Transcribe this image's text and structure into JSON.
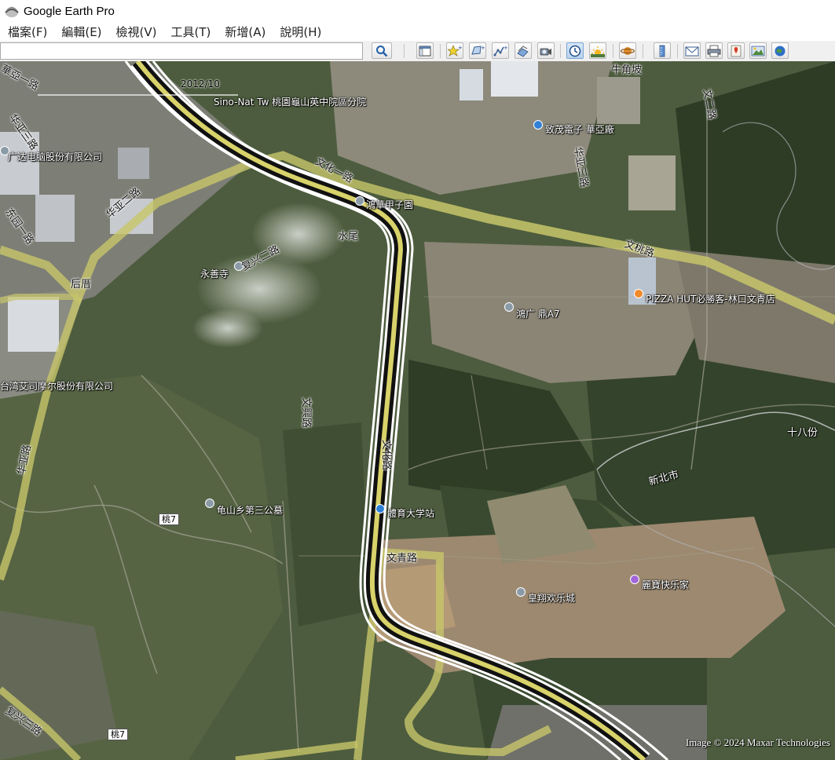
{
  "window": {
    "title": "Google Earth Pro"
  },
  "menu": [
    "檔案(F)",
    "編輯(E)",
    "檢視(V)",
    "工具(T)",
    "新增(A)",
    "說明(H)"
  ],
  "search": {
    "value": "",
    "placeholder": ""
  },
  "toolbar": {
    "icons": [
      "search-icon",
      "sidebar-toggle-icon",
      "placemark-icon",
      "polygon-icon",
      "path-icon",
      "overlay-icon",
      "tour-icon",
      "historical-imagery-icon",
      "sun-icon",
      "planets-icon",
      "ruler-icon",
      "email-icon",
      "print-icon",
      "save-image-icon",
      "maps-icon",
      "earth-icon"
    ]
  },
  "timeline": {
    "date": "2012/10"
  },
  "map": {
    "poi_labels": [
      "Sino-Nat Tw 桃園龜山英中院區分院",
      "致茂電子 華亞廠",
      "鴻華甲子園",
      "永善寺",
      "鴻广 鼎A7",
      "PIZZA HUT必勝客-林口文青店",
      "台湾艾司摩尔股份有限公司",
      "广达电脑股份有限公司",
      "龟山乡第三公墓",
      "體育大学站",
      "皇翔欢乐城",
      "麗寶快乐家"
    ],
    "road_labels": [
      "文化一路",
      "文化三路",
      "文化路",
      "文桃路",
      "文青路",
      "文興路",
      "复兴二路",
      "复兴一路",
      "文化二路",
      "華亞一路",
      "华亚二路",
      "华亚三路",
      "东园一路",
      "华亚路",
      "复兴三路",
      "华亚三路",
      "牛角坡",
      "文二路"
    ],
    "area_labels": [
      "水尾",
      "后厝",
      "十八份",
      "新北市"
    ],
    "route_shields": [
      "桃7",
      "桃7"
    ],
    "copyright": "Image © 2024 Maxar Technologies"
  }
}
